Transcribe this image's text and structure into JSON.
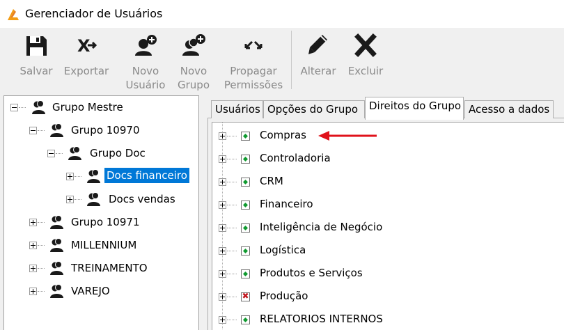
{
  "window": {
    "title": "Gerenciador de Usuários"
  },
  "toolbar": {
    "buttons": [
      {
        "label": "Salvar",
        "icon": "floppy-disk-icon"
      },
      {
        "label": "Exportar",
        "icon": "export-icon"
      },
      {
        "label": "Novo\nUsuário",
        "icon": "add-user-icon"
      },
      {
        "label": "Novo\nGrupo",
        "icon": "add-group-icon"
      },
      {
        "label": "Propagar\nPermissões",
        "icon": "propagate-icon"
      },
      {
        "label": "Alterar",
        "icon": "pencil-icon"
      },
      {
        "label": "Excluir",
        "icon": "delete-x-icon"
      }
    ]
  },
  "tree": {
    "items": [
      {
        "label": "Grupo Mestre",
        "expanded": true
      },
      {
        "label": "Grupo 10970",
        "expanded": true
      },
      {
        "label": "Grupo Doc",
        "expanded": true
      },
      {
        "label": "Docs financeiro",
        "selected": true
      },
      {
        "label": "Docs vendas"
      },
      {
        "label": "Grupo 10971"
      },
      {
        "label": "MILLENNIUM"
      },
      {
        "label": "TREINAMENTO"
      },
      {
        "label": "VAREJO"
      }
    ]
  },
  "tabs": [
    {
      "label": "Usuários"
    },
    {
      "label": "Opções do Grupo"
    },
    {
      "label": "Direitos do Grupo",
      "active": true
    },
    {
      "label": "Acesso a dados"
    }
  ],
  "rights": {
    "items": [
      {
        "label": "Compras",
        "state": "granted"
      },
      {
        "label": "Controladoria",
        "state": "granted"
      },
      {
        "label": "CRM",
        "state": "granted"
      },
      {
        "label": "Financeiro",
        "state": "granted"
      },
      {
        "label": "Inteligência de Negócio",
        "state": "granted"
      },
      {
        "label": "Logística",
        "state": "granted"
      },
      {
        "label": "Produtos e Serviços",
        "state": "granted"
      },
      {
        "label": "Produção",
        "state": "denied"
      },
      {
        "label": "RELATORIOS INTERNOS",
        "state": "granted"
      }
    ]
  },
  "colors": {
    "selection": "#0078d7",
    "granted": "#0f9a2f",
    "denied": "#c0141c",
    "arrow": "#e0121b"
  }
}
